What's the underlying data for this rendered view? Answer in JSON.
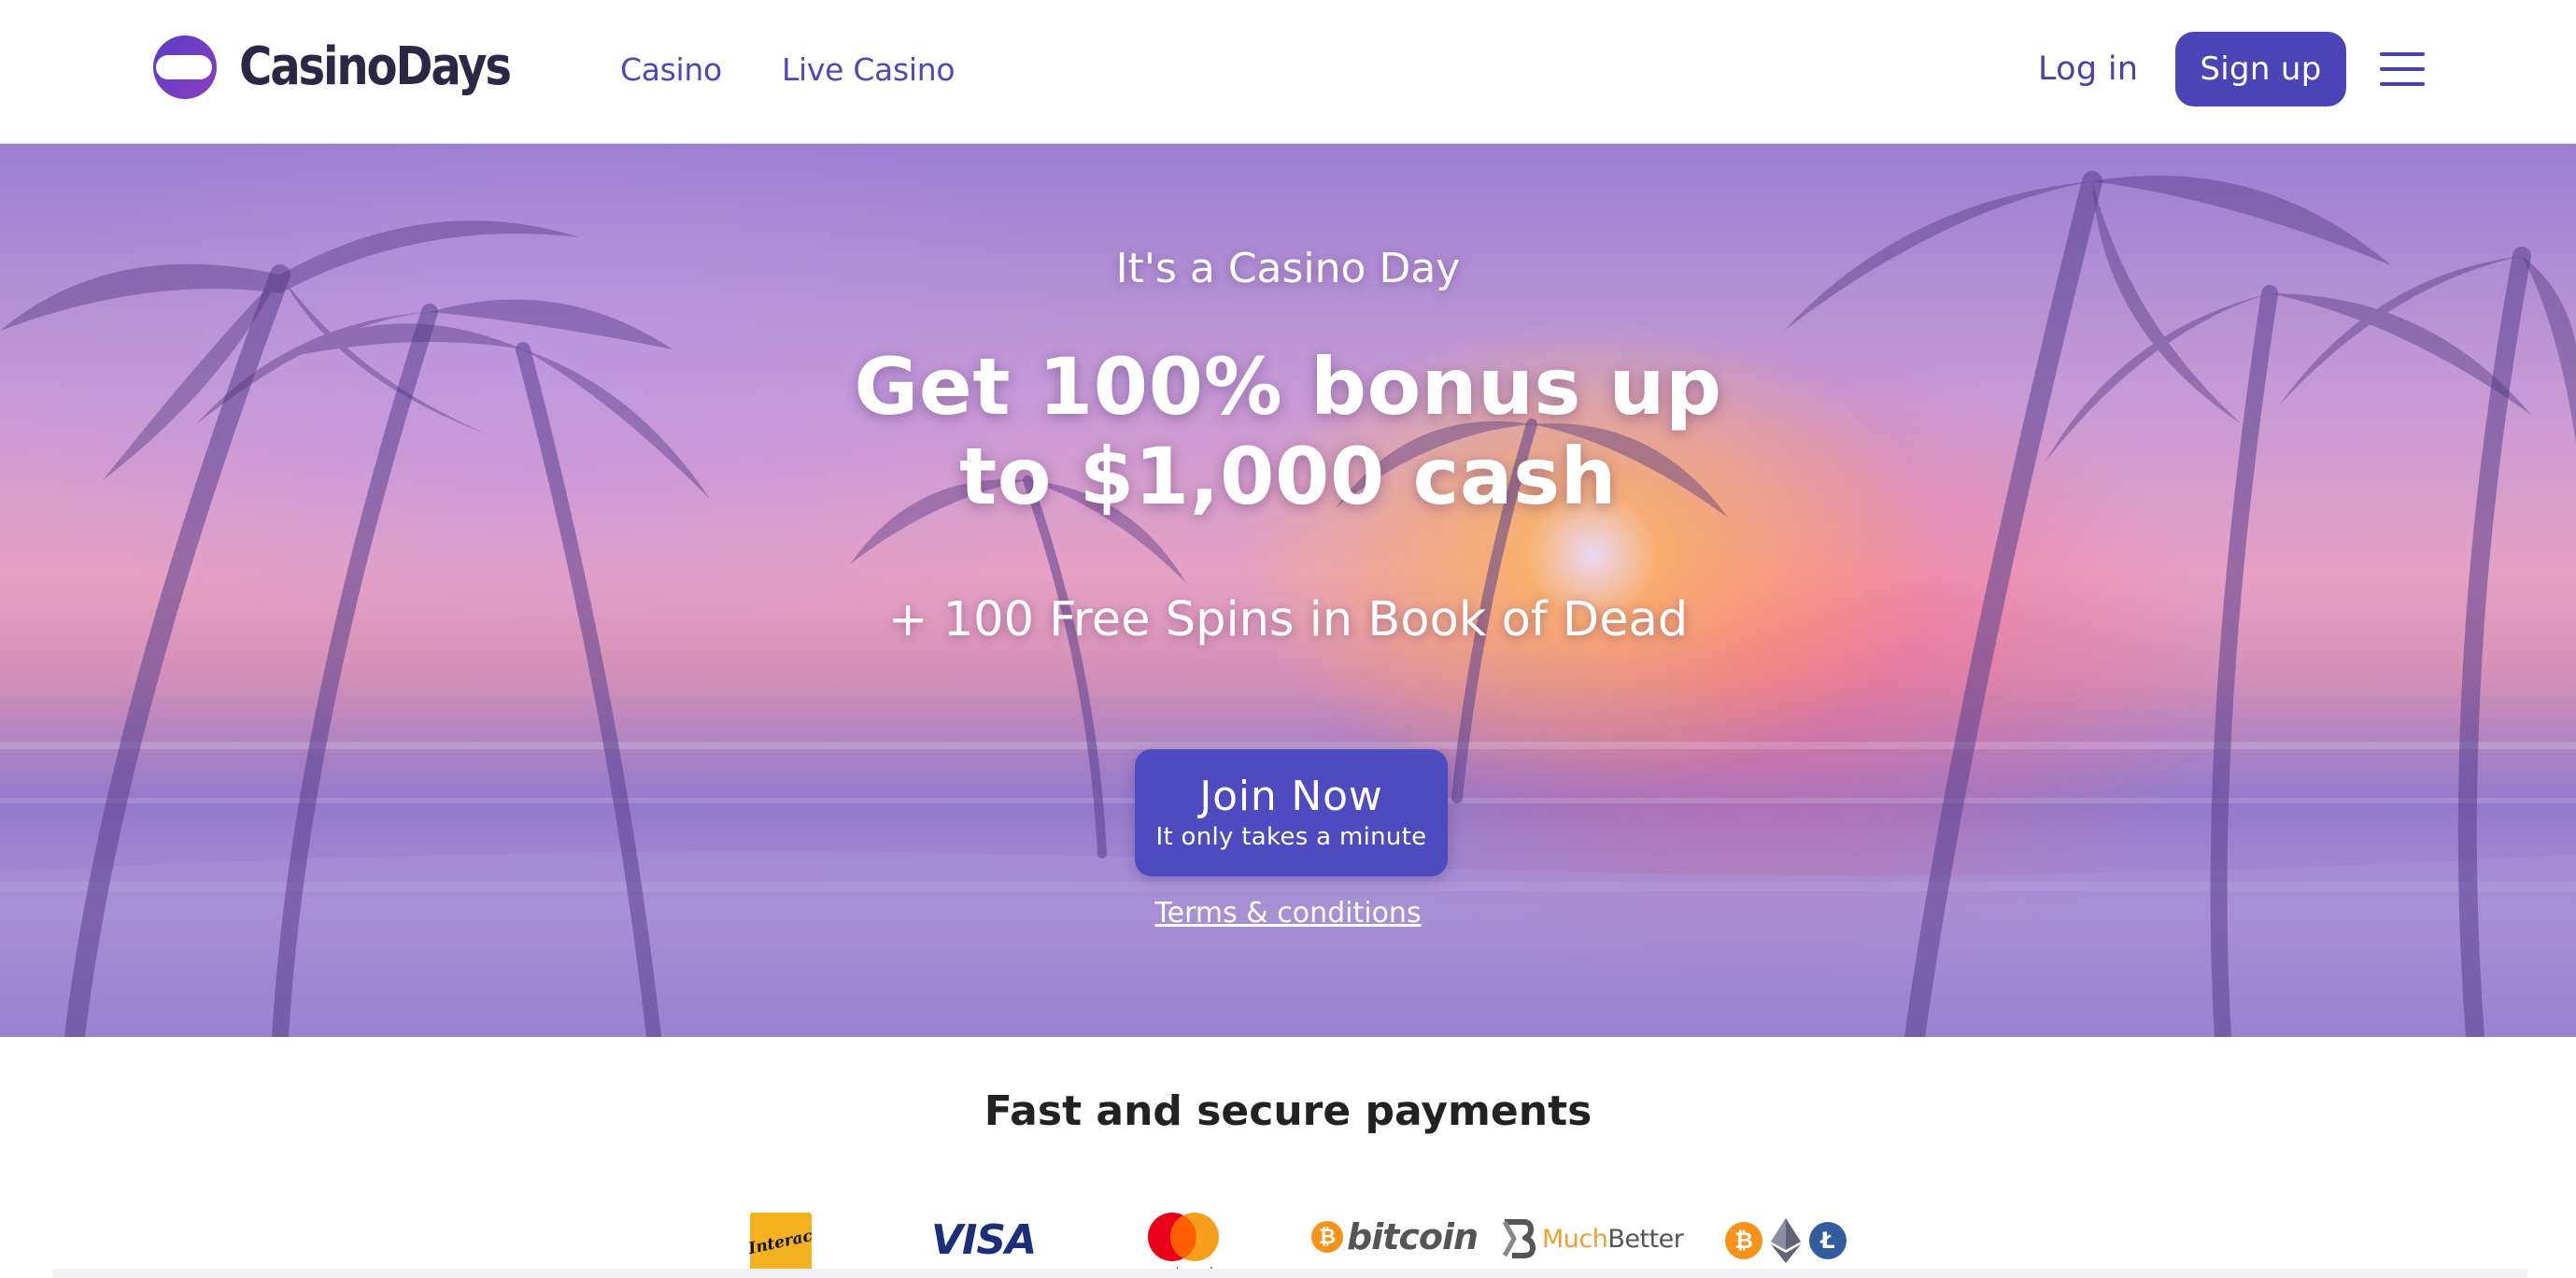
{
  "header": {
    "logo_text": "CasinoDays",
    "nav": [
      {
        "label": "Casino"
      },
      {
        "label": "Live Casino"
      }
    ],
    "login_label": "Log in",
    "signup_label": "Sign up",
    "menu_icon": "hamburger-menu-icon"
  },
  "hero": {
    "eyebrow": "It's a Casino Day",
    "headline": "Get 100% bonus up to $1,000 cash",
    "subline": "+ 100 Free Spins in Book of Dead",
    "cta_title": "Join Now",
    "cta_subtitle": "It only takes a minute",
    "terms_label": "Terms & conditions"
  },
  "payments": {
    "title": "Fast and secure payments",
    "methods": [
      {
        "name": "interac-logo",
        "text": "Interac"
      },
      {
        "name": "visa-logo",
        "text": "VISA"
      },
      {
        "name": "mastercard-logo",
        "text": "mastercard"
      },
      {
        "name": "bitcoin-logo",
        "text": "bitcoin"
      },
      {
        "name": "muchbetter-logo",
        "text_a": "Much",
        "text_b": "Better"
      },
      {
        "name": "crypto-coins-logo"
      }
    ]
  },
  "colors": {
    "brand": "#4b44b6",
    "nav_text": "#5048b5",
    "cta": "#4e4ac0",
    "logo_text": "#2b2845"
  }
}
